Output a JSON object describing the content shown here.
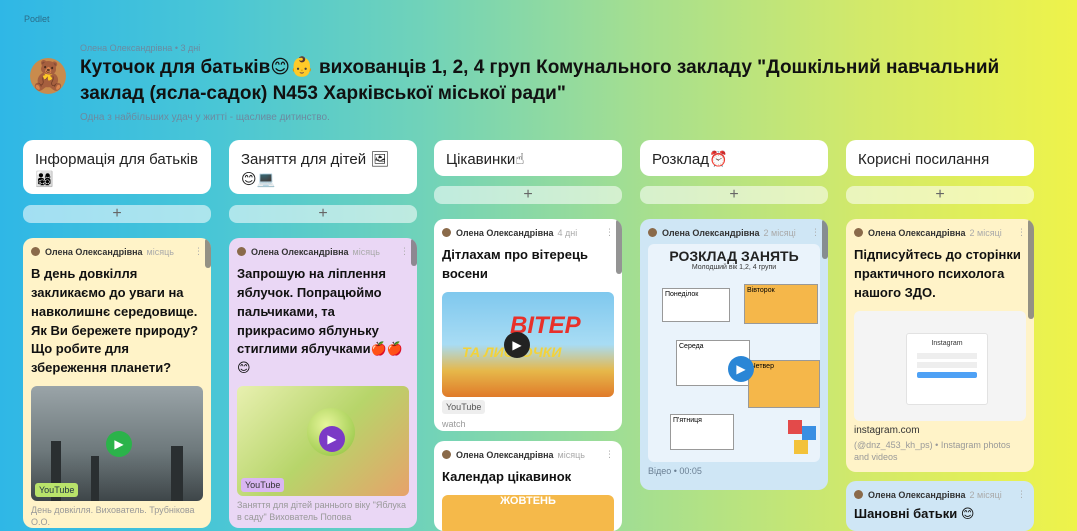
{
  "app": {
    "brand": "Podlet"
  },
  "board": {
    "meta": "Олена Олександрівна • 3 дні",
    "avatar_icon": "teddy-bear-icon",
    "title": "Куточок для батьків😊👶 вихованців 1, 2, 4 груп Комунального закладу \"Дошкільний навчальний заклад (ясла-садок) N453 Харківської міської ради\"",
    "subtitle": "Одна з найбільших удач у житті - щасливе дитинство."
  },
  "columns": [
    {
      "title": "Інформація для батьків 👨‍👩‍👧‍👦"
    },
    {
      "title": "Заняття для дітей 🖼 😊💻"
    },
    {
      "title": "Цікавинки☝"
    },
    {
      "title": "Розклад⏰"
    },
    {
      "title": "Корисні посилання"
    }
  ],
  "add_label": "+",
  "cards": {
    "c1": {
      "author": "Олена Олександрівна",
      "ago": "місяць",
      "title": "В день довкілля закликаємо до уваги на навколишнє середовище. Як Ви бережете природу? Що робите для збереження планети?",
      "source": "YouTube",
      "desc": "День довкілля. Вихователь. Трубнікова О.О."
    },
    "c2": {
      "author": "Олена Олександрівна",
      "ago": "місяць",
      "title": "Запрошую на ліплення яблучок. Попрацюймо пальчиками, та прикрасимо яблуньку стиглими яблучками🍎🍎😊",
      "source": "YouTube",
      "desc": "Заняття для дітей раннього віку \"Яблука в саду\" Вихователь Попова"
    },
    "c3": {
      "author": "Олена Олександрівна",
      "ago": "4 дні",
      "title": "Дітлахам про вітерець восени",
      "thumb_text_1": "ВІТЕР",
      "thumb_text_2": "ТА ЛИСТОЧКИ",
      "source": "YouTube",
      "action": "watch"
    },
    "c4": {
      "author": "Олена Олександрівна",
      "ago": "місяць",
      "title": "Календар цікавинок",
      "thumb_text": "ЖОВТЕНЬ"
    },
    "c5": {
      "author": "Олена Олександрівна",
      "ago": "2 місяці",
      "sched_title": "РОЗКЛАД ЗАНЯТЬ",
      "sched_sub": "Молодший вік 1,2, 4 групи",
      "days": [
        "Понеділок",
        "Вівторок",
        "Середа",
        "Четвер",
        "П'ятниця"
      ],
      "footer": "Відео • 00:05"
    },
    "c6": {
      "author": "Олена Олександрівна",
      "ago": "2 місяці",
      "title": "Підписуйтесь до сторінки практичного психолога нашого ЗДО.",
      "ig_label": "Instagram",
      "link": "instagram.com",
      "desc": "(@dnz_453_kh_ps) • Instagram photos and videos"
    },
    "c7": {
      "author": "Олена Олександрівна",
      "ago": "2 місяці",
      "title": "Шановні батьки 😊"
    }
  }
}
